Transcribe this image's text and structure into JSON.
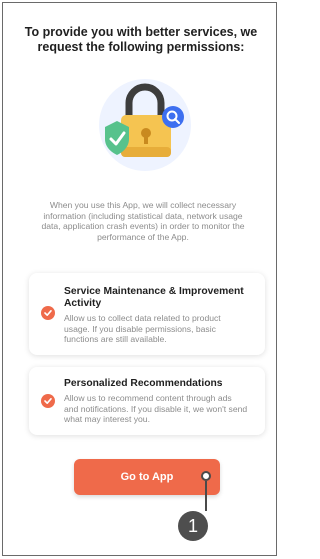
{
  "header": {
    "title_line1": "To provide you with better services, we",
    "title_line2": "request the following permissions:"
  },
  "description": {
    "line1": "When you use this App, we will collect necessary",
    "line2": "information (including statistical data, network usage",
    "line3": "data, application crash events) in order to monitor the",
    "line4": "performance of the App."
  },
  "permissions": [
    {
      "title_line1": "Service Maintenance & Improvement",
      "title_line2": "Activity",
      "text_line1": "Allow us to collect data related to product",
      "text_line2": "usage. If you disable permissions, basic",
      "text_line3": "functions are still available."
    },
    {
      "title_line1": "Personalized Recommendations",
      "text_line1": "Allow us to recommend content through ads",
      "text_line2": "and notifications. If you disable it, we won't send",
      "text_line3": "what may interest you."
    }
  ],
  "cta": {
    "label": "Go to App"
  },
  "annotation": {
    "step": "1"
  },
  "colors": {
    "accent": "#EF6A4A",
    "title": "#1F1F1F",
    "muted": "#8C8C8C"
  },
  "icons": {
    "illustration": "padlock-shield-search-illustration",
    "check": "check-circle-icon"
  }
}
